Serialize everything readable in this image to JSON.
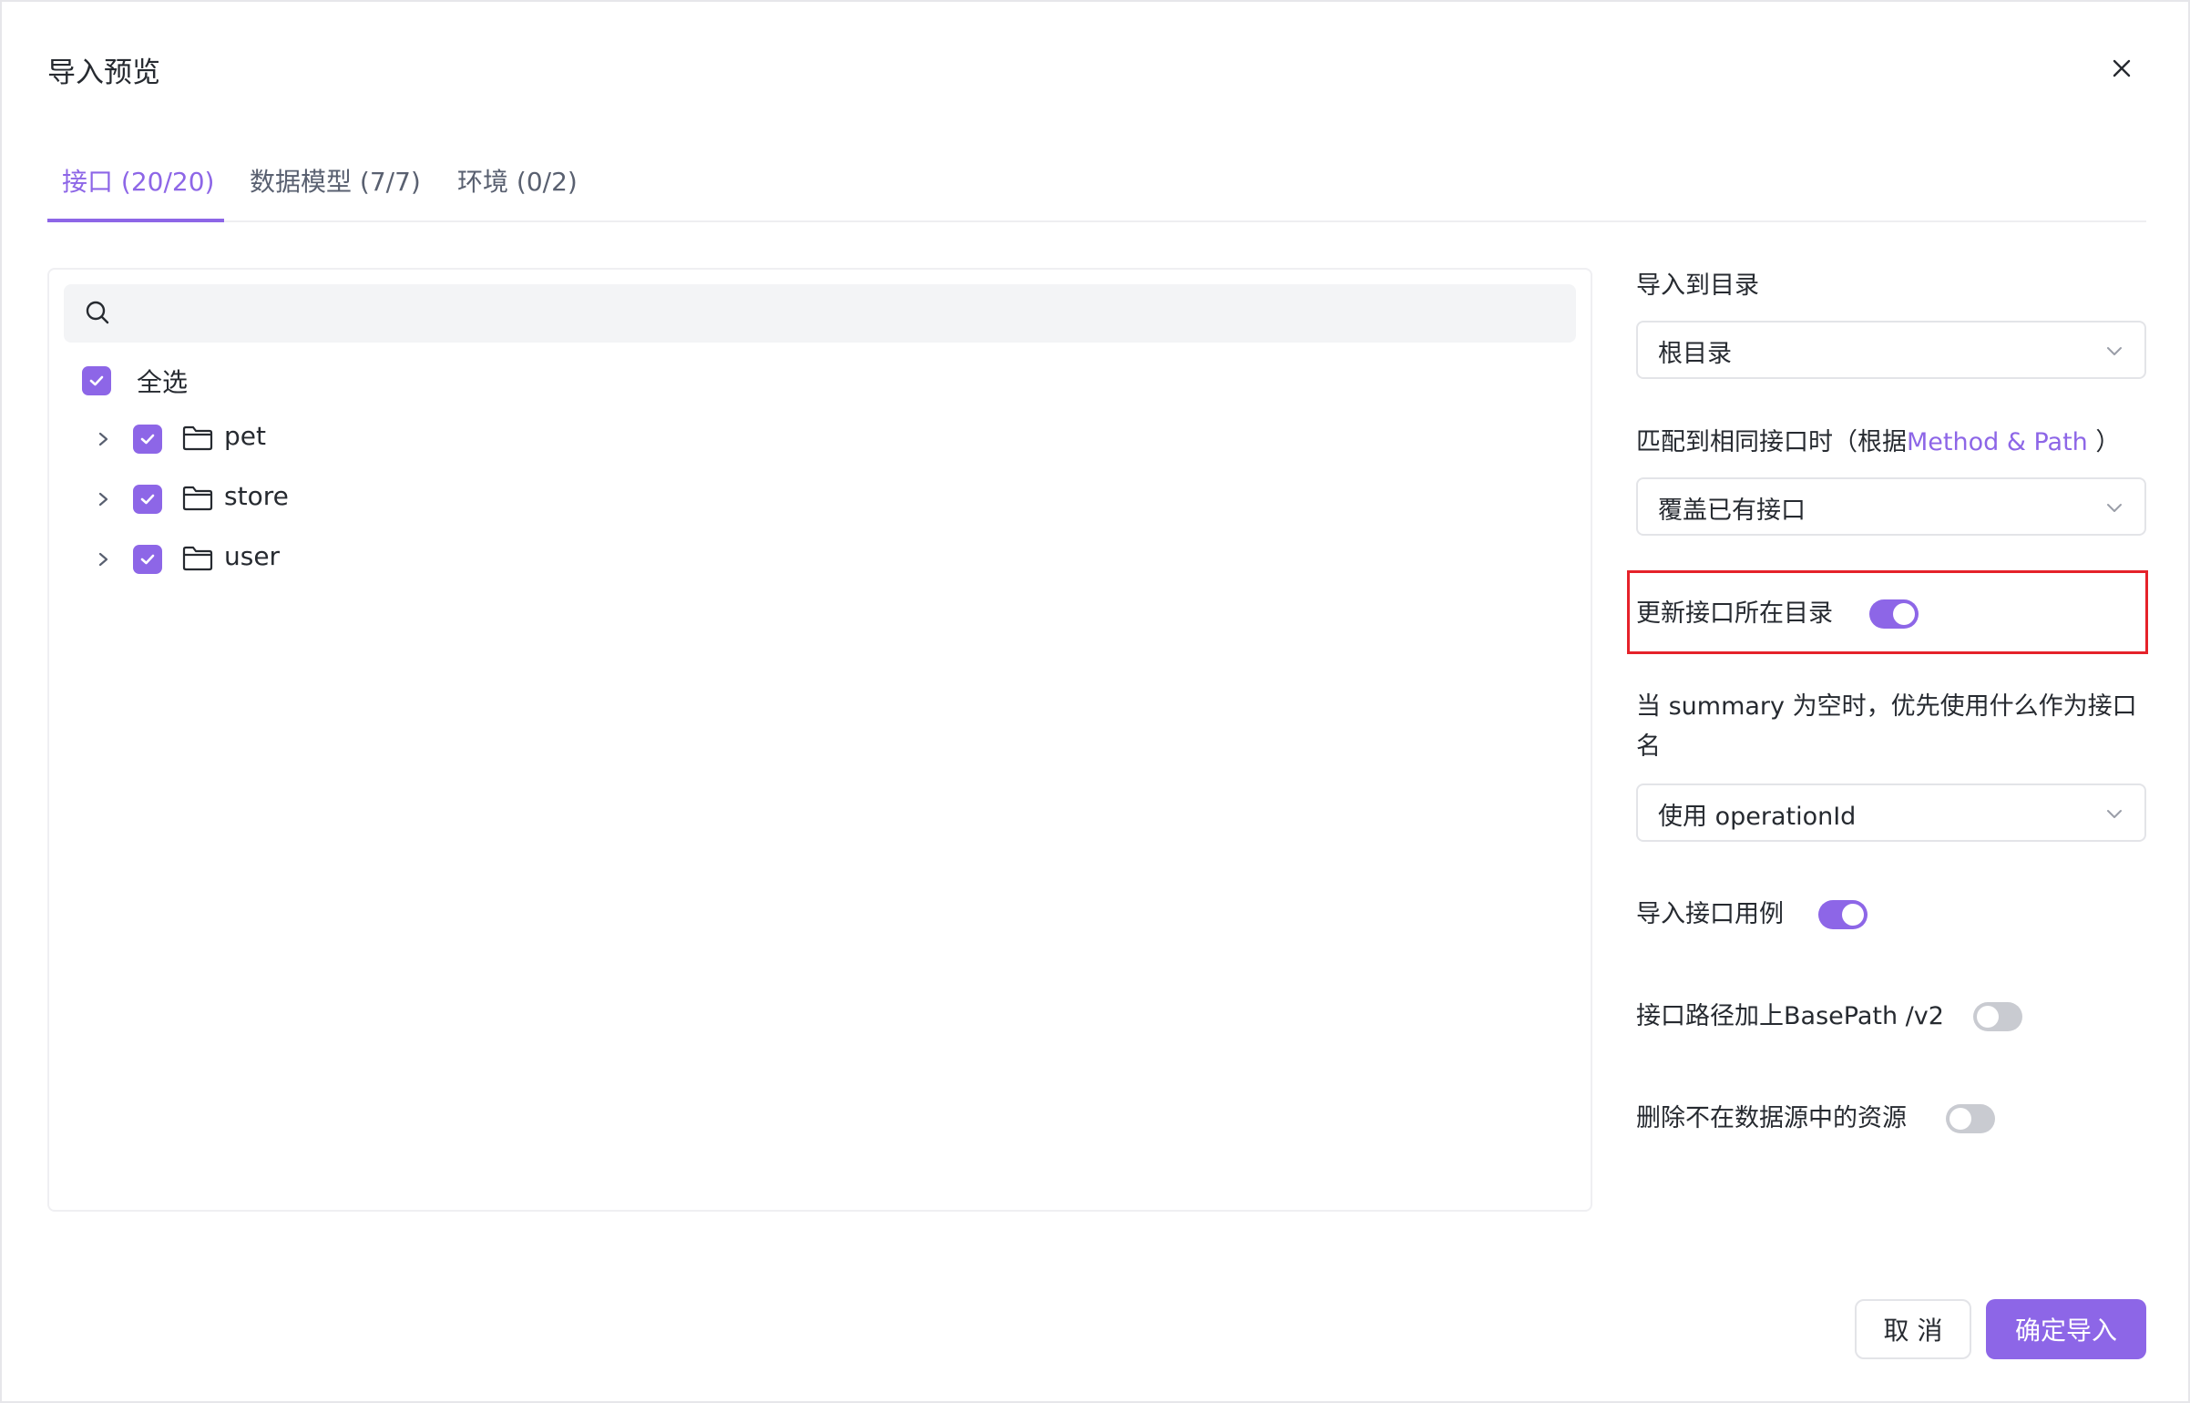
{
  "dialog": {
    "title": "导入预览"
  },
  "tabs": [
    {
      "label": "接口 (20/20)",
      "active": true
    },
    {
      "label": "数据模型 (7/7)",
      "active": false
    },
    {
      "label": "环境 (0/2)",
      "active": false
    }
  ],
  "tree": {
    "search_placeholder": "",
    "select_all_label": "全选",
    "items": [
      {
        "label": "pet",
        "checked": true
      },
      {
        "label": "store",
        "checked": true
      },
      {
        "label": "user",
        "checked": true
      }
    ]
  },
  "settings": {
    "import_dir_label": "导入到目录",
    "import_dir_value": "根目录",
    "match_label_prefix": "匹配到相同接口时（根据",
    "match_label_accent": "Method & Path",
    "match_label_suffix": "）",
    "match_value": "覆盖已有接口",
    "update_dir_label": "更新接口所在目录",
    "update_dir_on": true,
    "summary_label_line1": "当 summary 为空时，优先使用什么作为接口",
    "summary_label_line2": "名",
    "summary_value": "使用 operationId",
    "import_cases_label": "导入接口用例",
    "import_cases_on": true,
    "basepath_label": "接口路径加上BasePath /v2",
    "basepath_on": false,
    "delete_label": "删除不在数据源中的资源",
    "delete_on": false
  },
  "footer": {
    "cancel_label": "取 消",
    "confirm_label": "确定导入"
  },
  "colors": {
    "accent": "#8d66e7",
    "highlight_border": "#e5222a"
  }
}
